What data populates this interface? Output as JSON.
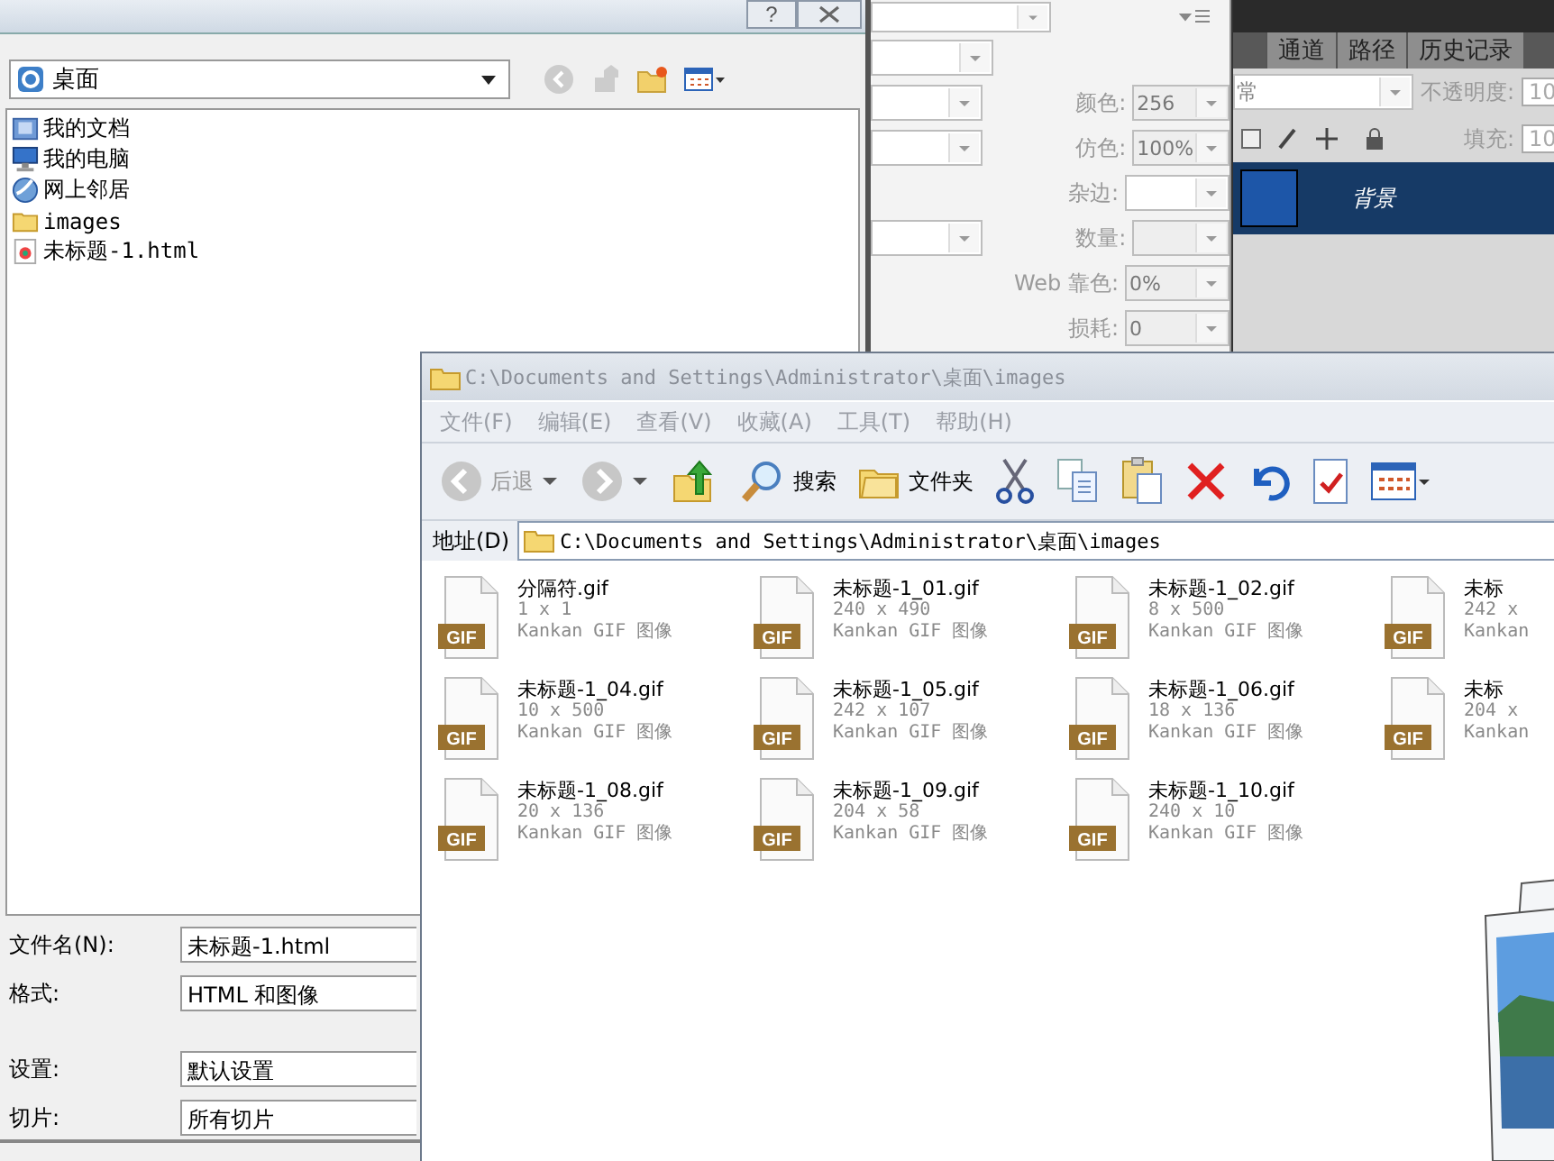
{
  "optimize_panel": {
    "rows": [
      {
        "label": "颜色:",
        "value": "256",
        "left_combo": true,
        "disabled": true
      },
      {
        "label": "仿色:",
        "value": "100%",
        "left_combo": true,
        "disabled": true
      },
      {
        "label": "杂边:",
        "left_combo": false,
        "disabled": false
      },
      {
        "label": "数量:",
        "left_combo": true,
        "disabled": true
      },
      {
        "label": "Web 靠色:",
        "value": "0%",
        "left_combo": false,
        "disabled": true
      },
      {
        "label": "损耗:",
        "value": "0",
        "left_combo": false,
        "disabled": true
      }
    ]
  },
  "layers_panel": {
    "tabs": [
      {
        "label": "通道",
        "selected": false
      },
      {
        "label": "路径",
        "selected": false
      },
      {
        "label": "历史记录",
        "selected": false
      }
    ],
    "blend_mode": "常",
    "opacity_label": "不透明度:",
    "opacity_value": "10",
    "fill_label": "填充:",
    "fill_value": "10",
    "layers": [
      {
        "name": "背景",
        "selected": true
      }
    ]
  },
  "save_dialog": {
    "help_label": "?",
    "location": "桌面",
    "items": [
      {
        "name": "我的文档",
        "kind": "documents"
      },
      {
        "name": "我的电脑",
        "kind": "computer"
      },
      {
        "name": "网上邻居",
        "kind": "network"
      },
      {
        "name": "images",
        "kind": "folder"
      },
      {
        "name": "未标题-1.html",
        "kind": "html"
      }
    ],
    "fields": [
      {
        "label": "文件名(N):",
        "value": "未标题-1.html"
      },
      {
        "label": "格式:",
        "value": "HTML 和图像"
      },
      {
        "label": "设置:",
        "value": "默认设置"
      },
      {
        "label": "切片:",
        "value": "所有切片"
      }
    ]
  },
  "explorer": {
    "title": "C:\\Documents and Settings\\Administrator\\桌面\\images",
    "menu": [
      "文件(F)",
      "编辑(E)",
      "查看(V)",
      "收藏(A)",
      "工具(T)",
      "帮助(H)"
    ],
    "toolbar": [
      {
        "kind": "back",
        "label": "后退"
      },
      {
        "kind": "forward"
      },
      {
        "kind": "up"
      },
      {
        "kind": "search",
        "label": "搜索"
      },
      {
        "kind": "folders",
        "label": "文件夹"
      },
      {
        "kind": "cut"
      },
      {
        "kind": "copy"
      },
      {
        "kind": "paste"
      },
      {
        "kind": "delete"
      },
      {
        "kind": "undo"
      },
      {
        "kind": "properties"
      },
      {
        "kind": "views"
      }
    ],
    "address_label": "地址(D)",
    "address": "C:\\Documents and Settings\\Administrator\\桌面\\images",
    "files": [
      {
        "name": "分隔符.gif",
        "size": "1 x 1",
        "type": "Kankan GIF 图像",
        "badge": "GIF"
      },
      {
        "name": "未标题-1_01.gif",
        "size": "240 x 490",
        "type": "Kankan GIF 图像",
        "badge": "GIF"
      },
      {
        "name": "未标题-1_02.gif",
        "size": "8 x 500",
        "type": "Kankan GIF 图像",
        "badge": "GIF"
      },
      {
        "name": "未标",
        "size": "242 x",
        "type": "Kankan",
        "badge": "GIF"
      },
      {
        "name": "未标题-1_04.gif",
        "size": "10 x 500",
        "type": "Kankan GIF 图像",
        "badge": "GIF"
      },
      {
        "name": "未标题-1_05.gif",
        "size": "242 x 107",
        "type": "Kankan GIF 图像",
        "badge": "GIF"
      },
      {
        "name": "未标题-1_06.gif",
        "size": "18 x 136",
        "type": "Kankan GIF 图像",
        "badge": "GIF"
      },
      {
        "name": "未标",
        "size": "204 x",
        "type": "Kankan",
        "badge": "GIF"
      },
      {
        "name": "未标题-1_08.gif",
        "size": "20 x 136",
        "type": "Kankan GIF 图像",
        "badge": "GIF"
      },
      {
        "name": "未标题-1_09.gif",
        "size": "204 x 58",
        "type": "Kankan GIF 图像",
        "badge": "GIF"
      },
      {
        "name": "未标题-1_10.gif",
        "size": "240 x 10",
        "type": "Kankan GIF 图像",
        "badge": "GIF"
      }
    ]
  }
}
